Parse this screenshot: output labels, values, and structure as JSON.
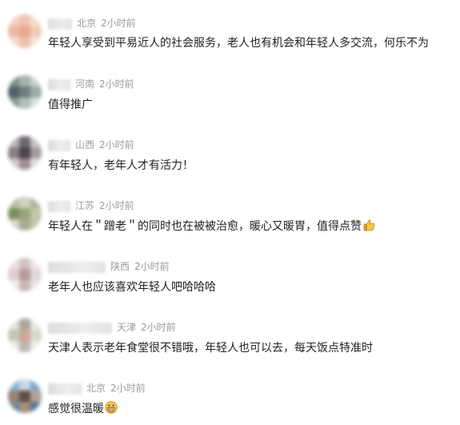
{
  "comments": [
    {
      "location": "北京",
      "time": "2小时前",
      "text": "年轻人享受到平易近人的社会服务，老人也有机会和年轻人多交流，何乐不为"
    },
    {
      "location": "河南",
      "time": "2小时前",
      "text": "值得推广"
    },
    {
      "location": "山西",
      "time": "2小时前",
      "text": "有年轻人，老年人才有活力！"
    },
    {
      "location": "江苏",
      "time": "2小时前",
      "text": "年轻人在＂蹭老＂的同时也在被被治愈，暖心又暖胃，值得点赞",
      "emoji": "thumbs-up-emoji"
    },
    {
      "location": "陕西",
      "time": "2小时前",
      "text": "老年人也应该喜欢年轻人吧哈哈哈"
    },
    {
      "location": "天津",
      "time": "2小时前",
      "text": "天津人表示老年食堂很不错哦，年轻人也可以去，每天饭点特准时"
    },
    {
      "location": "北京",
      "time": "2小时前",
      "text": "感觉很温暖",
      "emoji": "grinning-face-emoji"
    }
  ]
}
